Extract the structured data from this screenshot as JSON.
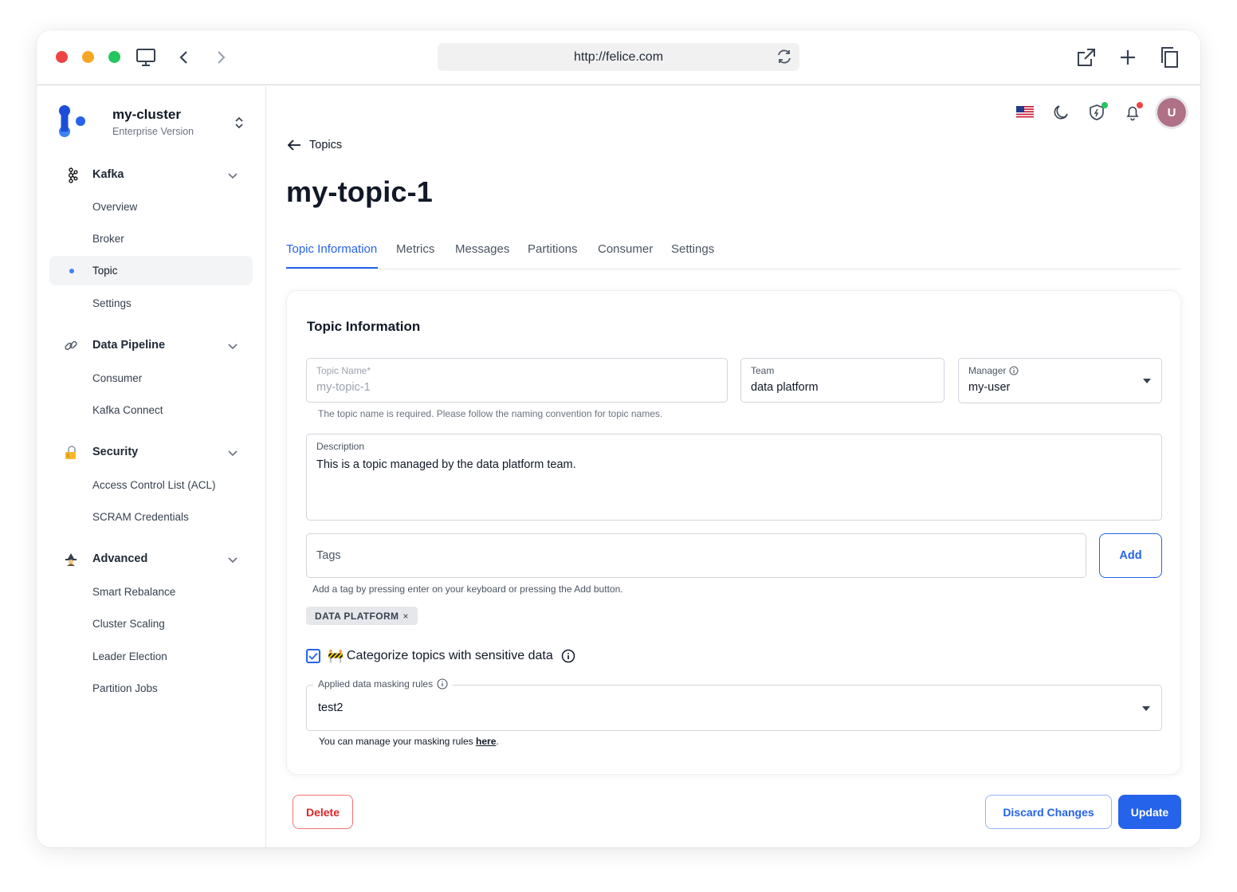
{
  "browser": {
    "url": "http://felice.com"
  },
  "sidebar": {
    "cluster": {
      "name": "my-cluster",
      "subtitle": "Enterprise Version"
    },
    "groups": [
      {
        "label": "Kafka",
        "icon": "kafka-icon",
        "items": [
          {
            "label": "Overview"
          },
          {
            "label": "Broker"
          },
          {
            "label": "Topic",
            "active": true
          },
          {
            "label": "Settings"
          }
        ]
      },
      {
        "label": "Data Pipeline",
        "icon": "link-icon",
        "items": [
          {
            "label": "Consumer"
          },
          {
            "label": "Kafka Connect"
          }
        ]
      },
      {
        "label": "Security",
        "icon": "lock-icon",
        "items": [
          {
            "label": "Access Control List (ACL)"
          },
          {
            "label": "SCRAM Credentials"
          }
        ]
      },
      {
        "label": "Advanced",
        "icon": "wizard-icon",
        "items": [
          {
            "label": "Smart Rebalance"
          },
          {
            "label": "Cluster Scaling"
          },
          {
            "label": "Leader Election"
          },
          {
            "label": "Partition Jobs"
          }
        ]
      }
    ]
  },
  "header": {
    "avatar_initial": "U"
  },
  "page": {
    "back_label": "Topics",
    "title": "my-topic-1",
    "tabs": [
      {
        "label": "Topic Information",
        "active": true
      },
      {
        "label": "Metrics"
      },
      {
        "label": "Messages"
      },
      {
        "label": "Partitions"
      },
      {
        "label": "Consumer"
      },
      {
        "label": "Settings"
      }
    ]
  },
  "form": {
    "card_title": "Topic Information",
    "topic_name": {
      "label": "Topic Name*",
      "value": "my-topic-1",
      "helper": "The topic name is required. Please follow the naming convention for topic names."
    },
    "team": {
      "label": "Team",
      "value": "data platform"
    },
    "manager": {
      "label": "Manager",
      "value": "my-user"
    },
    "description": {
      "label": "Description",
      "value": "This is a topic managed by the data platform team."
    },
    "tags": {
      "placeholder": "Tags",
      "add_label": "Add",
      "helper": "Add a tag by pressing enter on your keyboard or pressing the Add button.",
      "chips": [
        "DATA PLATFORM"
      ],
      "chip_remove": "×"
    },
    "sensitive": {
      "emoji": "🚧",
      "label": "Categorize topics with sensitive data",
      "checked": true
    },
    "masking": {
      "label": "Applied data masking rules",
      "value": "test2",
      "note_prefix": "You can manage your masking rules ",
      "note_link": "here",
      "note_suffix": "."
    }
  },
  "actions": {
    "delete": "Delete",
    "discard": "Discard Changes",
    "update": "Update"
  },
  "colors": {
    "accent": "#2563eb",
    "danger": "#dc2626"
  }
}
